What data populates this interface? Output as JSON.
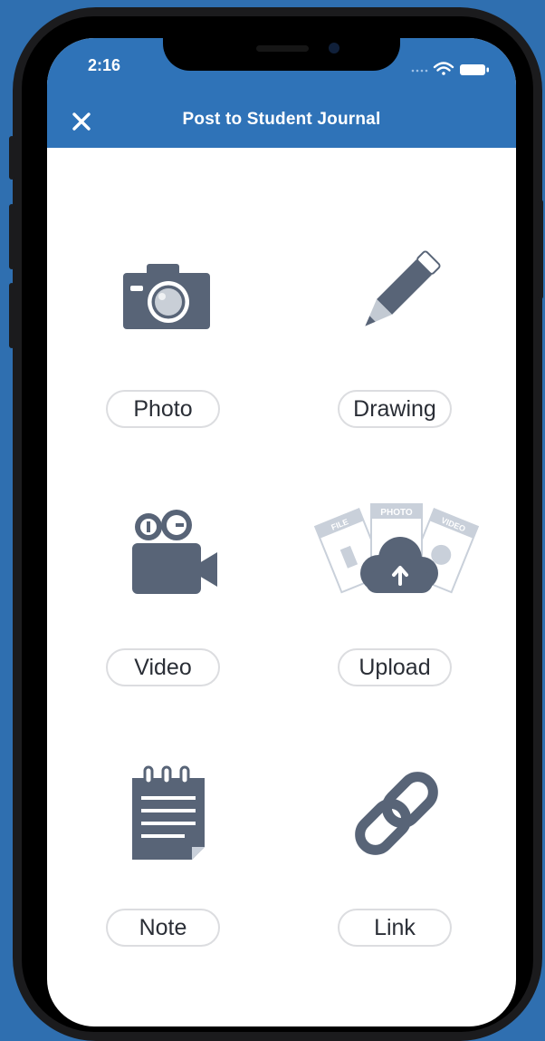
{
  "status_bar": {
    "time": "2:16"
  },
  "header": {
    "title": "Post to Student Journal",
    "close_icon": "close-icon"
  },
  "options": [
    {
      "label": "Photo",
      "icon": "camera-icon"
    },
    {
      "label": "Drawing",
      "icon": "pencil-icon"
    },
    {
      "label": "Video",
      "icon": "video-camera-icon"
    },
    {
      "label": "Upload",
      "icon": "cloud-upload-icon"
    },
    {
      "label": "Note",
      "icon": "notepad-icon"
    },
    {
      "label": "Link",
      "icon": "link-icon"
    }
  ],
  "upload_card_labels": [
    "FILE",
    "PHOTO",
    "VIDEO"
  ],
  "colors": {
    "brand": "#2f73b8",
    "icon": "#586477",
    "background": "#2f6fb0"
  }
}
